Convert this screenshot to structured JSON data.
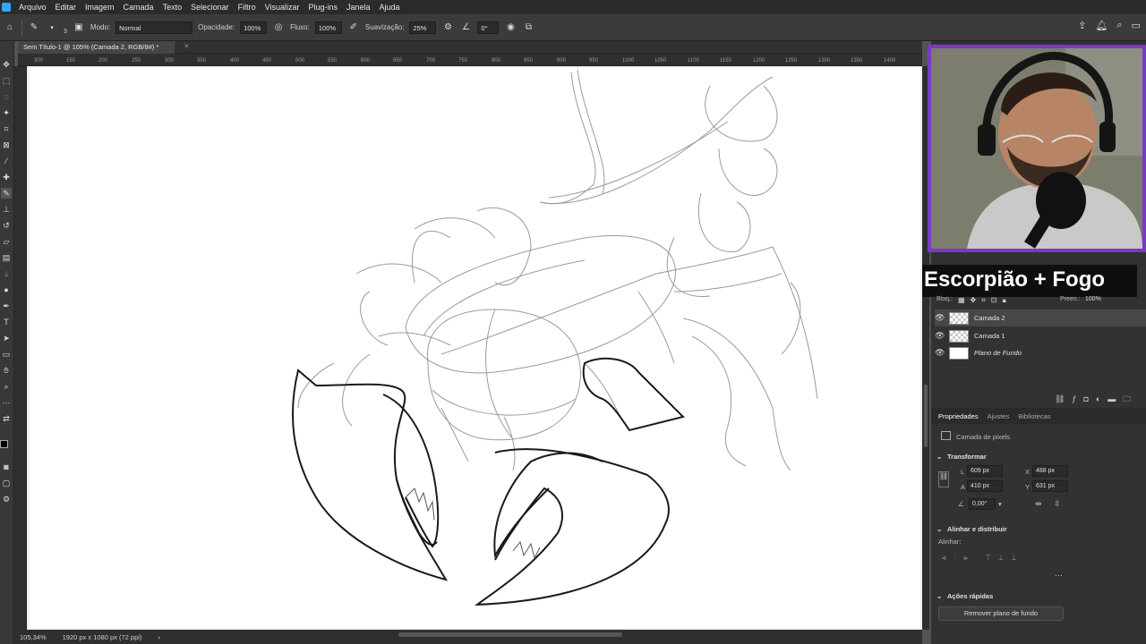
{
  "menu": [
    "Arquivo",
    "Editar",
    "Imagem",
    "Camada",
    "Texto",
    "Selecionar",
    "Filtro",
    "Visualizar",
    "Plug-ins",
    "Janela",
    "Ajuda"
  ],
  "options": {
    "brush_size": "3",
    "mode_label": "Modo:",
    "mode_value": "Normal",
    "opacity_label": "Opacidade:",
    "opacity_value": "100%",
    "flow_label": "Fluxo:",
    "flow_value": "100%",
    "smoothing_label": "Suavização:",
    "smoothing_value": "25%",
    "angle_value": "0°"
  },
  "document": {
    "tab_title": "Sem Título-1 @ 105% (Camada 2, RGB/8#) *",
    "zoom": "105,34%",
    "doc_size": "1920 px x 1080 px (72 ppi)"
  },
  "ruler_ticks": [
    "300",
    "150",
    "200",
    "250",
    "300",
    "350",
    "400",
    "450",
    "500",
    "550",
    "600",
    "650",
    "700",
    "750",
    "800",
    "850",
    "900",
    "950",
    "1000",
    "1050",
    "1100",
    "1150",
    "1200",
    "1250",
    "1300",
    "1350",
    "1400"
  ],
  "overlay_title": "Escorpião + Fogo",
  "layers": {
    "lock_label": "Bloq.:",
    "fill_label": "Preen.:",
    "fill_value": "100%",
    "items": [
      {
        "name": "Camada 2",
        "italic": false
      },
      {
        "name": "Camada 1",
        "italic": false
      },
      {
        "name": "Plano de Fundo",
        "italic": true
      }
    ]
  },
  "properties": {
    "tabs": [
      "Propriedades",
      "Ajustes",
      "Bibliotecas"
    ],
    "layer_type": "Camada de pixels",
    "transform_title": "Transformar",
    "w_label": "L",
    "w_value": "609 px",
    "h_label": "A",
    "h_value": "410 px",
    "x_label": "X",
    "x_value": "488 px",
    "y_label": "Y",
    "y_value": "631 px",
    "angle_value": "0,00°",
    "align_title": "Alinhar e distribuir",
    "align_label": "Alinhar:",
    "quick_title": "Ações rápidas",
    "quick_button": "Remover plano de fundo"
  }
}
